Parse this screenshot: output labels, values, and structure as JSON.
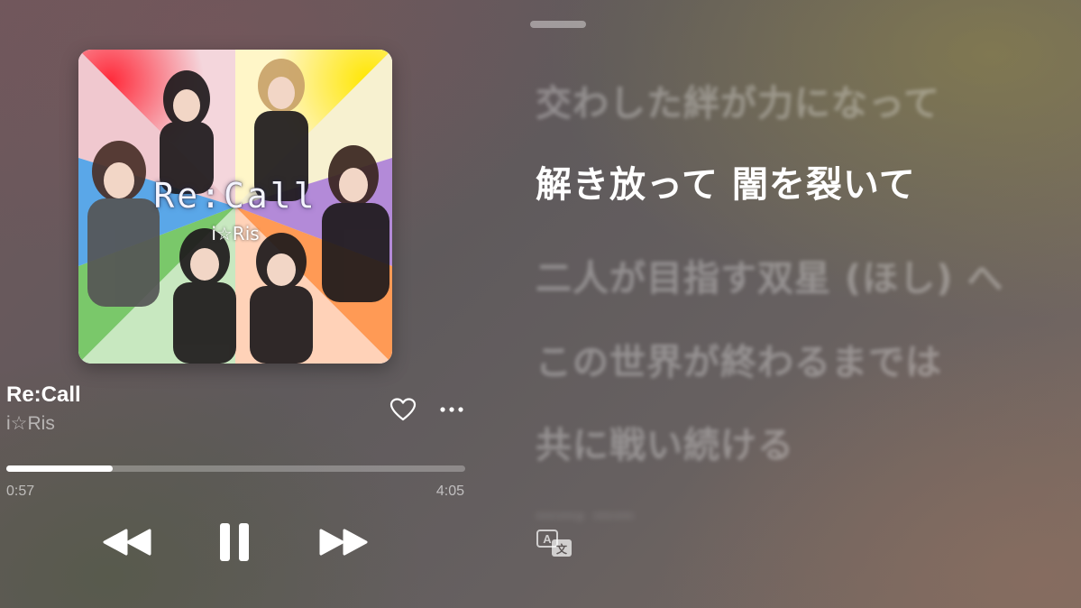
{
  "album": {
    "art_title": "Re:Call",
    "art_artist": "i☆Ris"
  },
  "track": {
    "title": "Re:Call",
    "artist": "i☆Ris",
    "elapsed": "0:57",
    "duration": "4:05",
    "progress": 0.232
  },
  "controls": {
    "favorite_icon": "heart-outline-icon",
    "more_icon": "ellipsis-icon",
    "rewind_icon": "rewind-icon",
    "pause_icon": "pause-icon",
    "forward_icon": "fast-forward-icon",
    "translate_icon": "translate-icon"
  },
  "lyrics": {
    "lines": [
      "交わした絆が力になって",
      "解き放って 闇を裂いて",
      "二人が目指す双星 (ほし) へ",
      "この世界が終わるまでは",
      "共に戦い続ける",
      "……, ……"
    ],
    "current_index": 1
  }
}
